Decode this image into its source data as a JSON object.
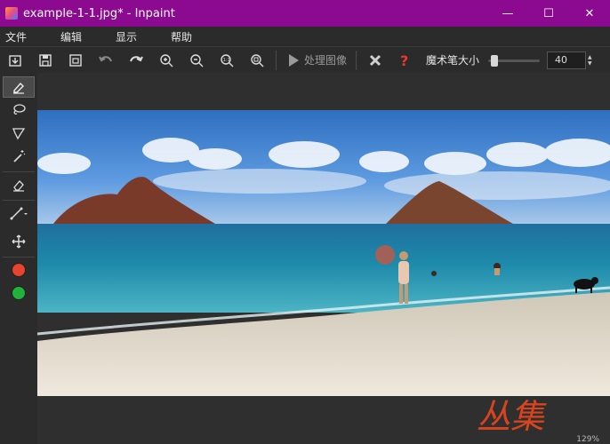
{
  "window": {
    "title": "example-1-1.jpg* - Inpaint",
    "controls": {
      "minimize": "—",
      "maximize": "☐",
      "close": "✕"
    }
  },
  "menu": {
    "items": [
      "文件",
      "编辑",
      "显示",
      "帮助"
    ]
  },
  "toolbar": {
    "process_label": "处理图像",
    "brush_label": "魔术笔大小",
    "brush_size": "40",
    "brush_level": 0.05
  },
  "tools": {
    "fg_color": "#e8432c",
    "bg_color": "#1fb33a"
  },
  "status": {
    "zoom": "129%"
  },
  "watermark": {
    "text": "丛集"
  }
}
